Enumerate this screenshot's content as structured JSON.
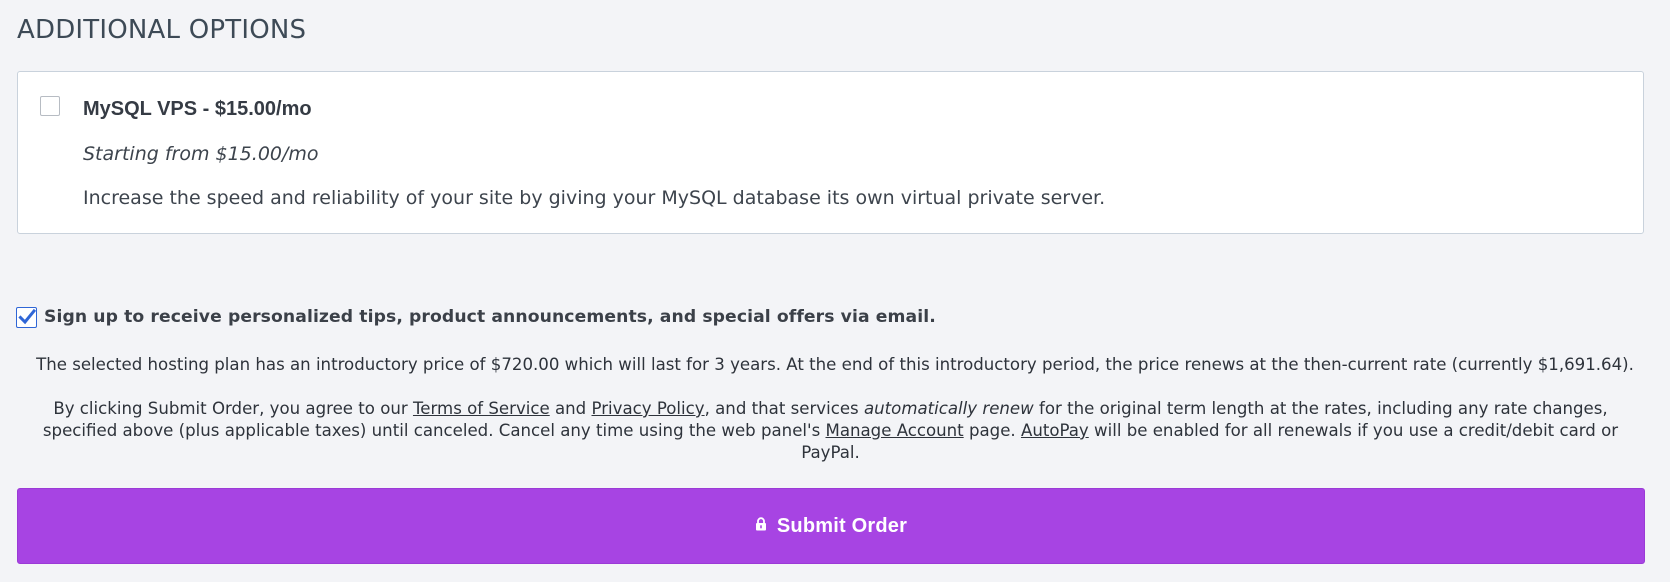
{
  "section": {
    "title": "ADDITIONAL OPTIONS"
  },
  "addon": {
    "checked": false,
    "title": "MySQL VPS - $15.00/mo",
    "starting": "Starting from $15.00/mo",
    "description": "Increase the speed and reliability of your site by giving your MySQL database its own virtual private server."
  },
  "signup": {
    "checked": true,
    "label": "Sign up to receive personalized tips, product announcements, and special offers via email."
  },
  "intro_price": "The selected hosting plan has an introductory price of $720.00 which will last for 3 years. At the end of this introductory period, the price renews at the then-current rate (currently $1,691.64).",
  "terms": {
    "part1": "By clicking Submit Order, you agree to our ",
    "tos_link": "Terms of Service",
    "part2": " and ",
    "privacy_link": "Privacy Policy",
    "part3": ", and that services ",
    "auto_renew": "automatically renew",
    "part4": " for the original term length at the rates, including any rate changes, specified above (plus applicable taxes) until canceled. Cancel any time using the web panel's ",
    "manage_link": "Manage Account",
    "part5": " page. ",
    "autopay_link": "AutoPay",
    "part6": " will be enabled for all renewals if you use a credit/debit card or PayPal."
  },
  "submit": {
    "label": "Submit Order",
    "icon": "lock-icon"
  },
  "colors": {
    "background": "#f3f4f7",
    "submit_button": "#a744e3",
    "checkbox_accent": "#2f66d6",
    "card_border": "#c9d2dc"
  }
}
